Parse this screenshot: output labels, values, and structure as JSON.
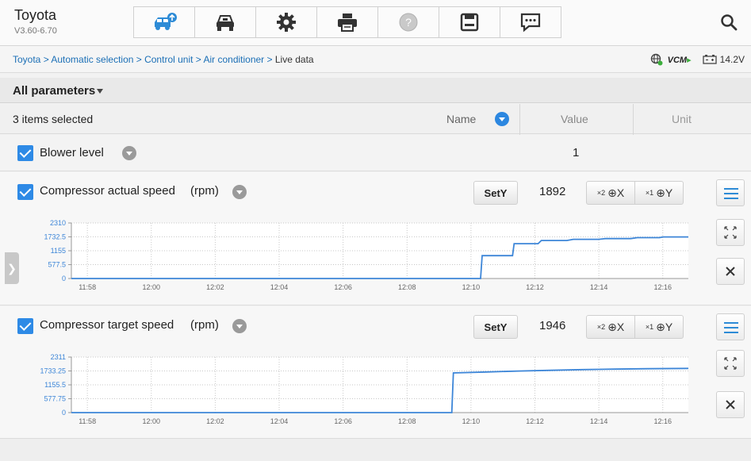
{
  "app": {
    "title": "Toyota",
    "version": "V3.60-6.70"
  },
  "toolbar": {
    "icons": [
      "vehicle-icon",
      "vehicle-lift-icon",
      "gear-icon",
      "printer-icon",
      "help-icon",
      "save-icon",
      "message-icon",
      "search-icon"
    ],
    "accent_color": "#2e8ae6"
  },
  "breadcrumb": {
    "path": "Toyota > Automatic selection > Control unit > Air conditioner >",
    "current": "Live data"
  },
  "status": {
    "vcm_label": "VCM",
    "voltage": "14.2V"
  },
  "params": {
    "header_label": "All parameters",
    "selected_text": "3 items selected",
    "col_name": "Name",
    "col_value": "Value",
    "col_unit": "Unit"
  },
  "rows": {
    "blower": {
      "label": "Blower level",
      "value": "1"
    }
  },
  "panels": [
    {
      "title": "Compressor actual speed",
      "unit": "(rpm)",
      "sety_label": "SetY",
      "value": "1892",
      "zoom_x_mult": "×2",
      "zoom_x_label": "X",
      "zoom_y_mult": "×1",
      "zoom_y_label": "Y"
    },
    {
      "title": "Compressor target speed",
      "unit": "(rpm)",
      "sety_label": "SetY",
      "value": "1946",
      "zoom_x_mult": "×2",
      "zoom_x_label": "X",
      "zoom_y_mult": "×1",
      "zoom_y_label": "Y"
    }
  ],
  "chart_data": [
    {
      "type": "line",
      "ylim": [
        0,
        2310
      ],
      "yticks": [
        "2310",
        "1732.5",
        "1155",
        "577.5",
        "0"
      ],
      "yticks_num": [
        2310,
        1732.5,
        1155,
        577.5,
        0
      ],
      "xlim": [
        717.5,
        736.8
      ],
      "xticks": [
        "11:58",
        "12:00",
        "12:02",
        "12:04",
        "12:06",
        "12:08",
        "12:10",
        "12:12",
        "12:14",
        "12:16"
      ],
      "xticks_num": [
        718,
        720,
        722,
        724,
        726,
        728,
        730,
        732,
        734,
        736
      ],
      "series": [
        {
          "color": "#3d86d8",
          "x": [
            717.5,
            730.3,
            730.35,
            731.3,
            731.35,
            732.1,
            732.2,
            733.0,
            733.2,
            734.0,
            734.2,
            735.0,
            735.2,
            735.9,
            736.0,
            736.8
          ],
          "y": [
            0,
            0,
            950,
            950,
            1450,
            1450,
            1580,
            1580,
            1630,
            1630,
            1660,
            1660,
            1700,
            1700,
            1730,
            1730
          ]
        }
      ]
    },
    {
      "type": "line",
      "ylim": [
        0,
        2311
      ],
      "yticks": [
        "2311",
        "1733.25",
        "1155.5",
        "577.75",
        "0"
      ],
      "yticks_num": [
        2311,
        1733.25,
        1155.5,
        577.75,
        0
      ],
      "xlim": [
        717.5,
        736.8
      ],
      "xticks": [
        "11:58",
        "12:00",
        "12:02",
        "12:04",
        "12:06",
        "12:08",
        "12:10",
        "12:12",
        "12:14",
        "12:16"
      ],
      "xticks_num": [
        718,
        720,
        722,
        724,
        726,
        728,
        730,
        732,
        734,
        736
      ],
      "series": [
        {
          "color": "#3d86d8",
          "x": [
            717.5,
            729.4,
            729.45,
            730.5,
            731.5,
            732.5,
            733.5,
            734.5,
            735.5,
            736.8
          ],
          "y": [
            0,
            0,
            1650,
            1690,
            1730,
            1760,
            1790,
            1810,
            1825,
            1840
          ]
        }
      ]
    }
  ]
}
